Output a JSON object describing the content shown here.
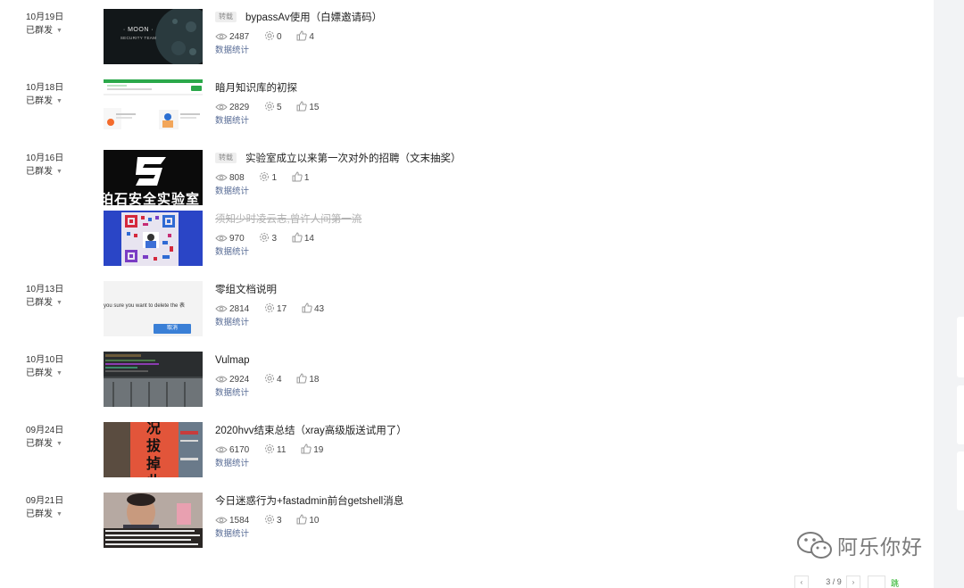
{
  "articles": [
    {
      "date": "10月19日",
      "status": "已群发",
      "tag": "转载",
      "title": "bypassAv使用（白嫖邀请码）",
      "views": "2487",
      "shares": "0",
      "likes": "4",
      "stats_link": "数据统计",
      "thumb_text": "· MOON ·",
      "thumb_subtext": "SECURITY TEAM"
    },
    {
      "date": "10月18日",
      "status": "已群发",
      "tag": "",
      "title": "暗月知识库的初探",
      "views": "2829",
      "shares": "5",
      "likes": "15",
      "stats_link": "数据统计"
    },
    {
      "date": "10月16日",
      "status": "已群发",
      "tag": "转载",
      "title": "实验室成立以来第一次对外的招聘（文末抽奖）",
      "views": "808",
      "shares": "1",
      "likes": "1",
      "stats_link": "数据统计",
      "thumb_text": "珀石安全实验室"
    },
    {
      "date": "",
      "status": "",
      "tag": "",
      "title": "须知少时凌云志,曾许人间第一流",
      "views": "970",
      "shares": "3",
      "likes": "14",
      "stats_link": "数据统计"
    },
    {
      "date": "10月13日",
      "status": "已群发",
      "tag": "",
      "title": "零组文档说明",
      "views": "2814",
      "shares": "17",
      "likes": "43",
      "stats_link": "数据统计",
      "thumb_text": "you sure you want to delete the 表",
      "thumb_button": "取消"
    },
    {
      "date": "10月10日",
      "status": "已群发",
      "tag": "",
      "title": "Vulmap",
      "views": "2924",
      "shares": "4",
      "likes": "18",
      "stats_link": "数据统计"
    },
    {
      "date": "09月24日",
      "status": "已群发",
      "tag": "",
      "title": "2020hvv结束总结（xray高级版送试用了）",
      "views": "6170",
      "shares": "11",
      "likes": "19",
      "stats_link": "数据统计",
      "thumb_text": "况拔掉此"
    },
    {
      "date": "09月21日",
      "status": "已群发",
      "tag": "",
      "title": "今日迷惑行为+fastadmin前台getshell消息",
      "views": "1584",
      "shares": "3",
      "likes": "10",
      "stats_link": "数据统计"
    }
  ],
  "pagination": {
    "prev": "‹",
    "next": "›",
    "page_text": "3 / 9",
    "jump_label": "跳转"
  },
  "watermark": {
    "text": "阿乐你好"
  },
  "colors": {
    "link": "#576b95",
    "jump": "#1aad19",
    "deleted": "#b0b0b0"
  }
}
